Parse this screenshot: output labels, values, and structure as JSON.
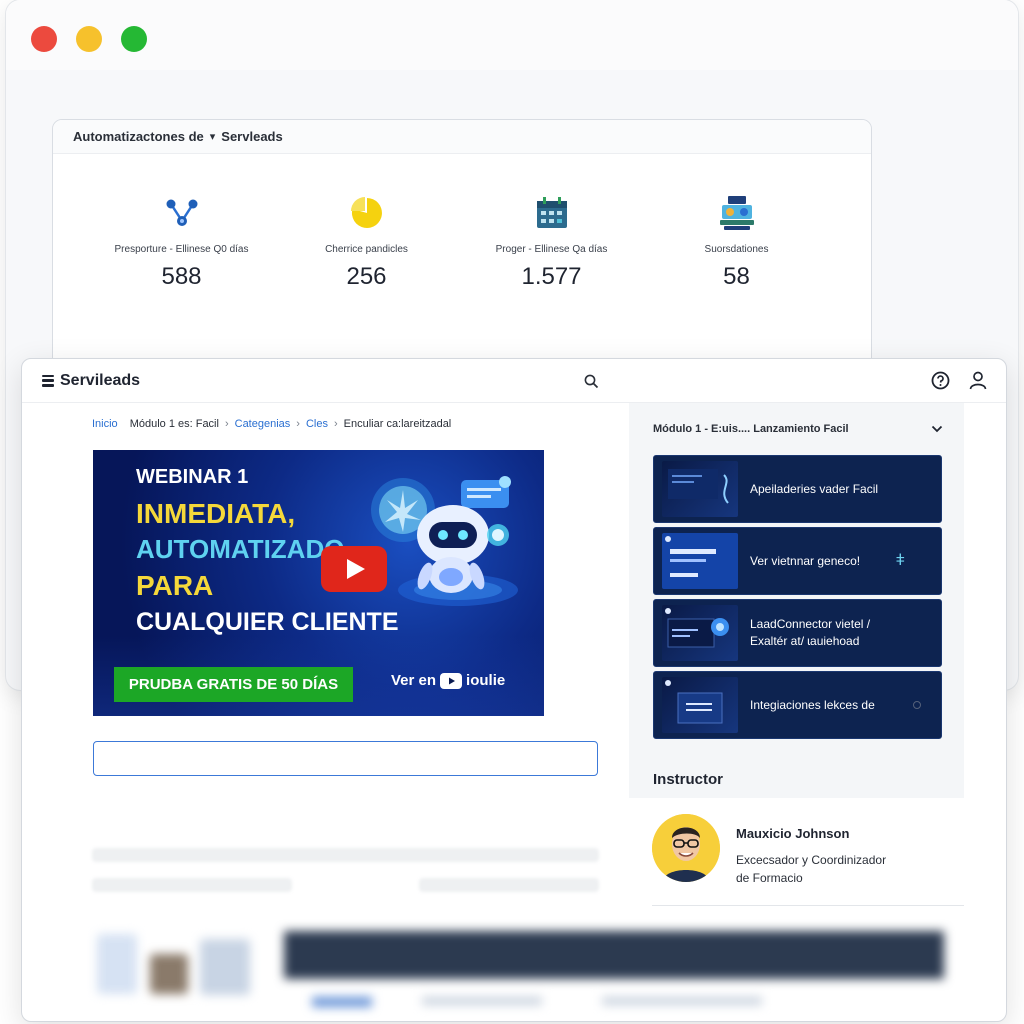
{
  "stats": {
    "title_prefix": "Automatizactones de",
    "title_brand": "Servleads",
    "items": [
      {
        "label": "Presporture - Ellinese Q0 días",
        "value": "588",
        "icon": "workflow-icon"
      },
      {
        "label": "Cherrice pandicles",
        "value": "256",
        "icon": "pie-chart-icon"
      },
      {
        "label": "Proger - Ellinese Qa días",
        "value": "1.577",
        "icon": "calendar-icon"
      },
      {
        "label": "Suorsdationes",
        "value": "58",
        "icon": "team-icon"
      }
    ]
  },
  "app": {
    "brand": "Servileads"
  },
  "breadcrumb": {
    "home": "Inicio",
    "module": "Módulo 1 es: Facil",
    "categories": "Categenias",
    "cles": "Cles",
    "current": "Enculiar ca:lareitzadal"
  },
  "video": {
    "line1": "WEBINAR 1",
    "line2": "INMEDIATA,",
    "line3": "AUTOMATIZADO",
    "line4": "PARA",
    "line5": "CUALQUIER CLIENTE",
    "cta": "PRUDBA GRATIS DE 50 DÍAS",
    "watch_on": "Ver en",
    "platform": "ioulie"
  },
  "sidebar": {
    "module_title": "Módulo 1 - E:uis.... Lanzamiento Facil",
    "lessons": [
      {
        "title": "Apeiladeries vader Facil"
      },
      {
        "title": "Ver vietnnar geneco!",
        "badge": "ǂ"
      },
      {
        "title": "LaadConnector vietel /",
        "title2": "Exaltér at/ ɩauiehoad"
      },
      {
        "title": "Integiaciones lekces de"
      }
    ],
    "instructor_heading": "Instructor"
  },
  "instructor": {
    "name": "Mauxicio Johnson",
    "role_line1": "Excecsador y Coordinizador",
    "role_line2": "de Formacio"
  },
  "colors": {
    "accent": "#2a6fd1",
    "cta_green": "#1ca726",
    "lesson_bg": "#0d2350",
    "video_yellow": "#f5d83a"
  }
}
